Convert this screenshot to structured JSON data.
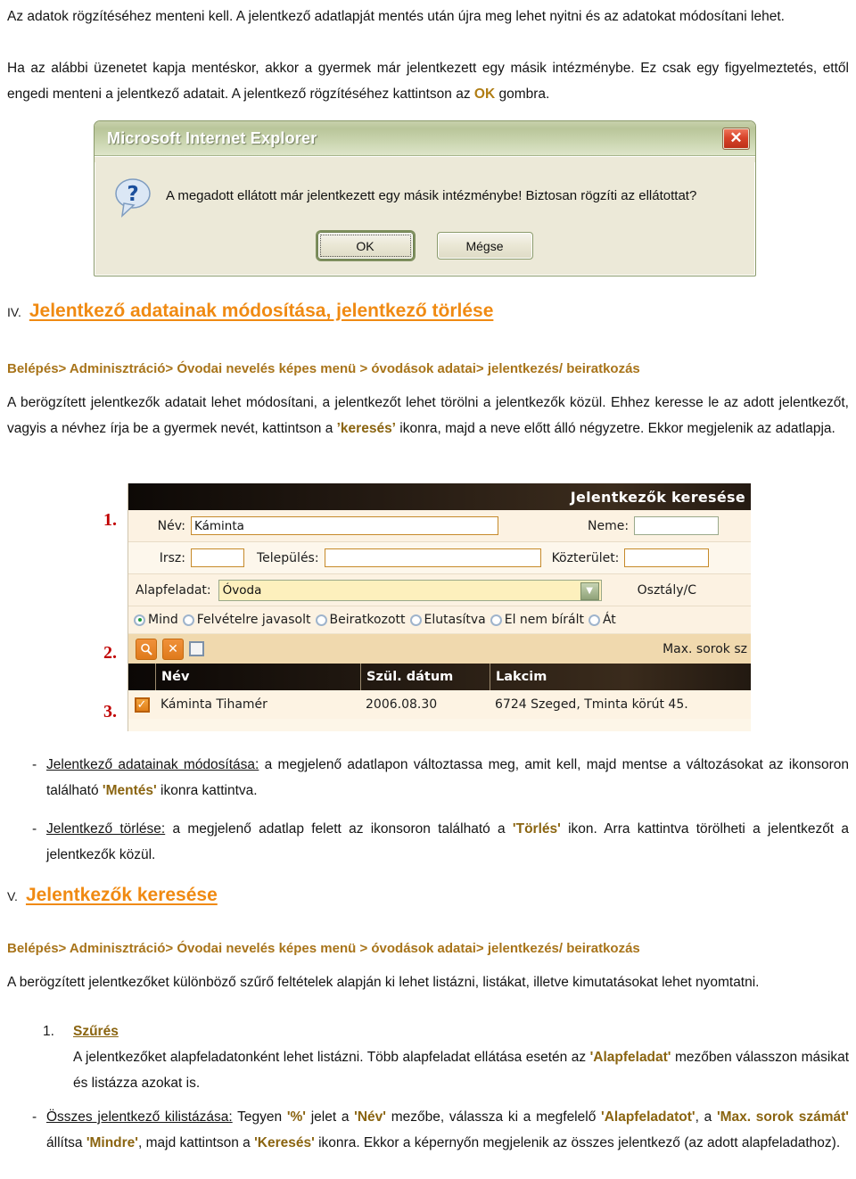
{
  "intro": {
    "p1": "Az adatok rögzítéséhez menteni kell. A jelentkező adatlapját mentés után újra meg lehet nyitni és az adatokat módosítani lehet.",
    "p2_a": "Ha az alábbi üzenetet kapja mentéskor, akkor a gyermek már jelentkezett egy másik intézménybe. Ez csak egy figyelmeztetés, ettől engedi menteni a jelentkező adatait. A jelentkező rögzítéséhez kattintson az ",
    "p2_ok": "OK",
    "p2_b": " gombra."
  },
  "dialog": {
    "title": "Microsoft Internet Explorer",
    "close_label": "✕",
    "icon": "question-mark-icon",
    "message": "A megadott ellátott már jelentkezett egy másik intézménybe! Biztosan rögzíti az ellátottat?",
    "ok_label": "OK",
    "cancel_label": "Mégse"
  },
  "section4": {
    "number": "IV.",
    "title": "Jelentkező adatainak módosítása, jelentkező törlése",
    "breadcrumb": "Belépés> Adminisztráció> Óvodai nevelés képes menü > óvodások adatai> jelentkezés/ beiratkozás",
    "body_a": "A berögzített jelentkezők adatait lehet módosítani, a jelentkezőt lehet törölni a jelentkezők közül. Ehhez keresse le az adott jelentkezőt, vagyis a névhez írja be a gyermek nevét, kattintson a ",
    "body_keres": "’keresés’",
    "body_b": " ikonra, majd a neve előtt álló négyzetre. Ekkor megjelenik az adatlapja."
  },
  "screenshot": {
    "markers": [
      "1.",
      "2.",
      "3."
    ],
    "title": "Jelentkezők keresése",
    "row1": {
      "nev_label": "Név:",
      "nev_value": "Káminta",
      "neme_label": "Neme:",
      "neme_value": ""
    },
    "row2": {
      "irsz_label": "Irsz:",
      "irsz_value": "",
      "telepules_label": "Település:",
      "telepules_value": "",
      "kozterulet_label": "Közterület:",
      "kozterulet_value": ""
    },
    "row3": {
      "alapfeladat_label": "Alapfeladat:",
      "alapfeladat_value": "Óvoda",
      "osztaly_label": "Osztály/C"
    },
    "radios": [
      {
        "label": "Mind",
        "selected": true
      },
      {
        "label": "Felvételre javasolt",
        "selected": false
      },
      {
        "label": "Beiratkozott",
        "selected": false
      },
      {
        "label": "Elutasítva",
        "selected": false
      },
      {
        "label": "El nem bírált",
        "selected": false
      },
      {
        "label": "Át",
        "selected": false
      }
    ],
    "toolbar": {
      "search_icon": "magnifier-icon",
      "delete_icon": "x-icon",
      "checkbox_label": "",
      "maxrows_label": "Max. sorok sz"
    },
    "table": {
      "headers": [
        "",
        "Név",
        "Szül. dátum",
        "Lakcim"
      ],
      "rows": [
        {
          "checked": true,
          "nev": "Káminta Tihamér",
          "datum": "2006.08.30",
          "lakcim": "6724 Szeged, Tminta körút 45."
        }
      ]
    }
  },
  "bullets": [
    {
      "bullet": "-",
      "lead": "Jelentkező adatainak módosítása:",
      "text_a": " a megjelenő adatlapon változtassa meg, amit kell, majd mentse a változásokat az ikonsoron található ",
      "hl": "'Mentés'",
      "text_b": " ikonra kattintva."
    },
    {
      "bullet": "-",
      "lead": "Jelentkező törlése:",
      "text_a": " a megjelenő adatlap felett az ikonsoron található a ",
      "hl": "'Törlés'",
      "text_b": " ikon. Arra kattintva törölheti a jelentkezőt a jelentkezők közül."
    }
  ],
  "section5": {
    "number": "V.",
    "title": "Jelentkezők keresése",
    "breadcrumb": "Belépés> Adminisztráció> Óvodai nevelés képes menü > óvodások adatai> jelentkezés/ beiratkozás",
    "body": "A berögzített jelentkezőket különböző szűrő feltételek alapján ki lehet listázni, listákat, illetve kimutatásokat lehet nyomtatni."
  },
  "sub1": {
    "number": "1.",
    "title": "Szűrés",
    "text_a": "A jelentkezőket alapfeladatonként lehet listázni. Több alapfeladat ellátása esetén az ",
    "hl": "'Alapfeladat'",
    "text_b": " mezőben válasszon másikat és listázza azokat is."
  },
  "sub2": {
    "bullet": "-",
    "lead": "Összes jelentkező kilistázása:",
    "t1": " Tegyen ",
    "h1": "'%'",
    "t2": " jelet a ",
    "h2": "'Név'",
    "t3": " mezőbe, válassza ki a megfelelő ",
    "h3": "'Alapfeladatot'",
    "t4": ", a ",
    "h4": "'Max. sorok számát'",
    "t5": " állítsa ",
    "h5": "'Mindre'",
    "t6": ", majd kattintson a ",
    "h6": "'Keresés'",
    "t7": " ikonra. Ekkor a képernyőn megjelenik az összes jelentkező (az adott alapfeladathoz)."
  }
}
